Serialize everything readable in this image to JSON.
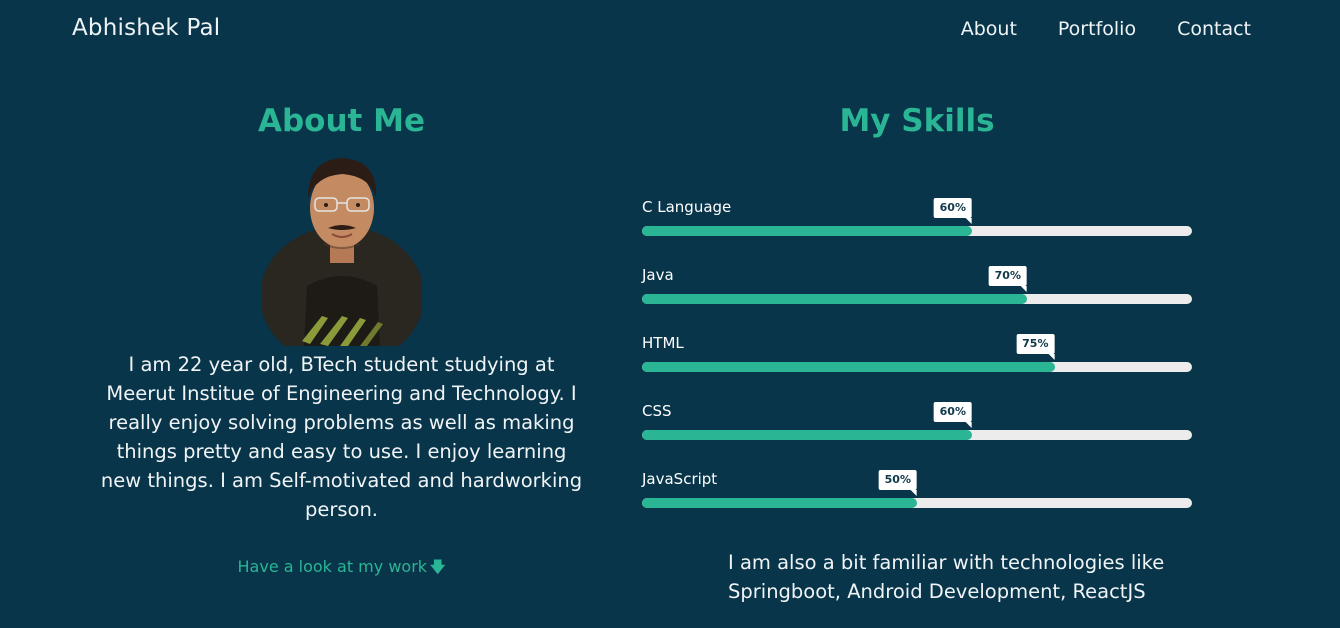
{
  "header": {
    "brand": "Abhishek Pal",
    "nav": [
      "About",
      "Portfolio",
      "Contact"
    ]
  },
  "about": {
    "title": "About Me",
    "bio": "I am 22 year old, BTech student studying at Meerut Institue of Engineering and Technology. I really enjoy solving problems as well as making things pretty and easy to use. I enjoy learning new things. I am Self-motivated and hardworking person.",
    "work_link": "Have a look at my work",
    "work_link_icon": "arrow-down-icon"
  },
  "skills": {
    "title": "My Skills",
    "items": [
      {
        "name": "C Language",
        "percent": 60,
        "label": "60%"
      },
      {
        "name": "Java",
        "percent": 70,
        "label": "70%"
      },
      {
        "name": "HTML",
        "percent": 75,
        "label": "75%"
      },
      {
        "name": "CSS",
        "percent": 60,
        "label": "60%"
      },
      {
        "name": "JavaScript",
        "percent": 50,
        "label": "50%"
      }
    ],
    "familiar": "I am also a bit familiar with technologies like Springboot, Android Development, ReactJS"
  },
  "colors": {
    "background": "#08354a",
    "accent": "#2ab595",
    "track": "#ececec"
  }
}
